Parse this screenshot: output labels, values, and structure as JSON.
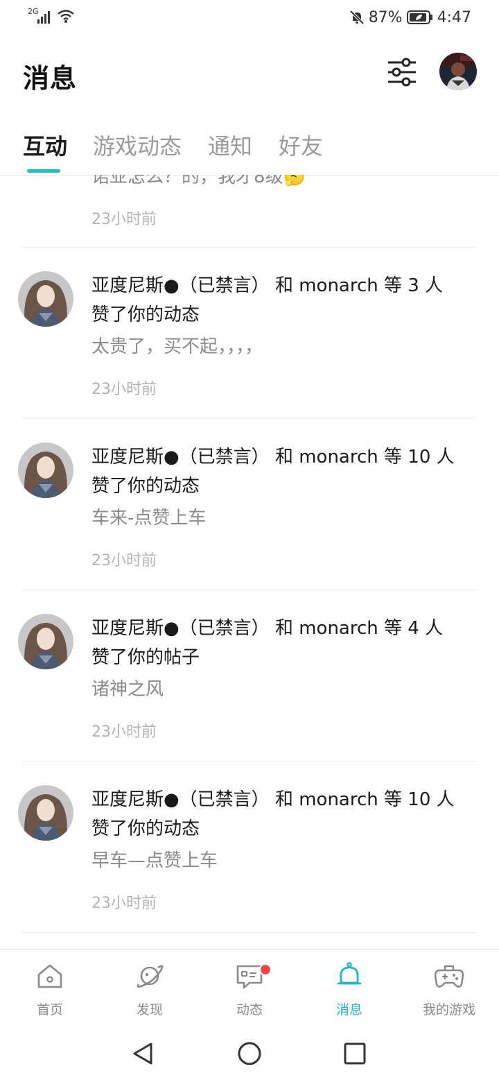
{
  "status_bar": {
    "network": "2G",
    "battery": "87%",
    "time": "4:47"
  },
  "header": {
    "title": "消息"
  },
  "tabs": [
    {
      "label": "互动"
    },
    {
      "label": "游戏动态"
    },
    {
      "label": "通知"
    },
    {
      "label": "好友"
    }
  ],
  "partial_item": {
    "text": "诺亚怎么？的，我才8级🤔",
    "time": "23小时前"
  },
  "items": [
    {
      "line1": "亚度尼斯●（已禁言） 和 monarch 等 3 人",
      "line2": "赞了你的动态",
      "body": "太贵了，买不起，，，，",
      "time": "23小时前"
    },
    {
      "line1": "亚度尼斯●（已禁言） 和 monarch 等 10 人",
      "line2": "赞了你的动态",
      "body": "车来-点赞上车",
      "time": "23小时前"
    },
    {
      "line1": "亚度尼斯●（已禁言） 和 monarch 等 4 人",
      "line2": "赞了你的帖子",
      "body": "诸神之风",
      "time": "23小时前"
    },
    {
      "line1": "亚度尼斯●（已禁言） 和 monarch 等 10 人",
      "line2": "赞了你的动态",
      "body": "早车—点赞上车",
      "time": "23小时前"
    }
  ],
  "bottom_nav": [
    {
      "label": "首页",
      "icon": "home-icon"
    },
    {
      "label": "发现",
      "icon": "planet-icon"
    },
    {
      "label": "动态",
      "icon": "chat-icon"
    },
    {
      "label": "消息",
      "icon": "bell-icon"
    },
    {
      "label": "我的游戏",
      "icon": "gamepad-icon"
    }
  ],
  "colors": {
    "accent": "#1fc0c9",
    "badge": "#f04848"
  }
}
